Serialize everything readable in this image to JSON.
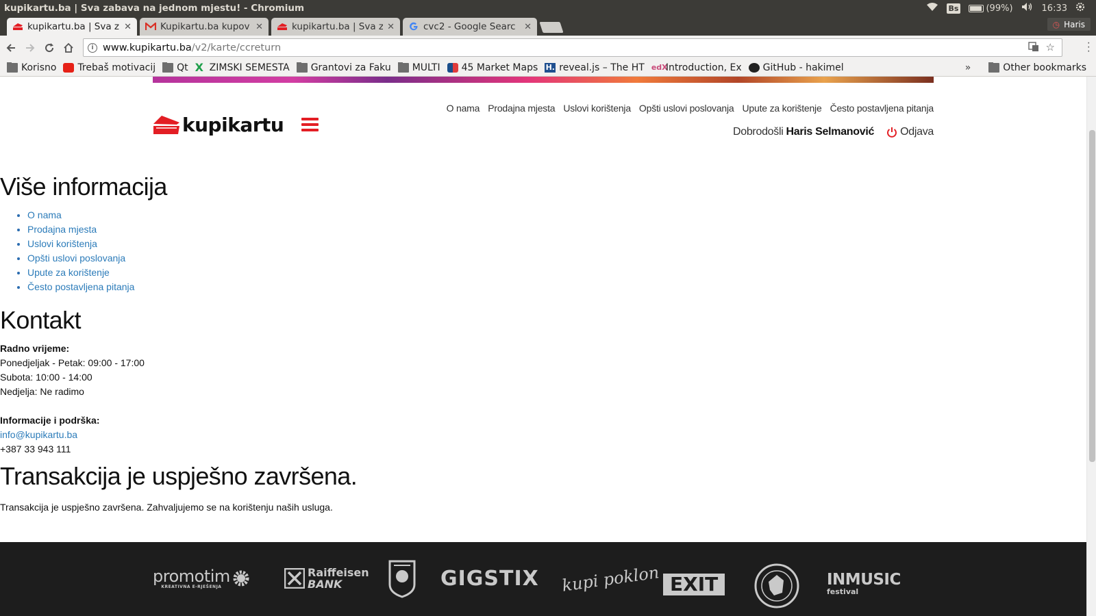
{
  "os": {
    "window_title": "kupikartu.ba | Sva zabava na jednom mjestu! - Chromium",
    "keyboard_layout": "Bs",
    "battery": "(99%)",
    "time": "16:33",
    "user": "Haris"
  },
  "tabs": [
    {
      "title": "kupikartu.ba | Sva z",
      "icon": "kupikartu-favicon",
      "active": true
    },
    {
      "title": "Kupikartu.ba kupov",
      "icon": "gmail-favicon",
      "active": false
    },
    {
      "title": "kupikartu.ba | Sva z",
      "icon": "kupikartu-favicon",
      "active": false
    },
    {
      "title": "cvc2 - Google Searc",
      "icon": "google-favicon",
      "active": false
    }
  ],
  "address": {
    "host": "www.kupikartu.ba",
    "path": "/v2/karte/ccreturn"
  },
  "bookmarks": [
    {
      "label": "Korisno",
      "icon": "folder-icon"
    },
    {
      "label": "Trebaš motivacij",
      "icon": "youtube-icon"
    },
    {
      "label": "Qt",
      "icon": "folder-icon"
    },
    {
      "label": "ZIMSKI SEMESTA",
      "icon": "x-icon"
    },
    {
      "label": "Grantovi za Faku",
      "icon": "folder-icon"
    },
    {
      "label": "MULTI",
      "icon": "folder-icon"
    },
    {
      "label": "45 Market Maps",
      "icon": "app-icon"
    },
    {
      "label": "reveal.js – The HT",
      "icon": "h-icon"
    },
    {
      "label": "Introduction, Ex",
      "icon": "edx-icon"
    },
    {
      "label": "GitHub - hakimel",
      "icon": "github-icon"
    }
  ],
  "bookmarks_more": "»",
  "other_bookmarks": "Other bookmarks",
  "site": {
    "logo_text": "kupikartu",
    "topnav": [
      "O nama",
      "Prodajna mjesta",
      "Uslovi korištenja",
      "Opšti uslovi poslovanja",
      "Upute za korištenje",
      "Često postavljena pitanja"
    ],
    "welcome": "Dobrodošli",
    "user_name": "Haris Selmanović",
    "logout": "Odjava"
  },
  "content": {
    "more_info_heading": "Više informacija",
    "more_info_links": [
      "O nama",
      "Prodajna mjesta",
      "Uslovi korištenja",
      "Opšti uslovi poslovanja",
      "Upute za korištenje",
      "Često postavljena pitanja"
    ],
    "contact_heading": "Kontakt",
    "hours_label": "Radno vrijeme:",
    "hours": [
      "Ponedjeljak - Petak: 09:00 - 17:00",
      "Subota: 10:00 - 14:00",
      "Nedjelja: Ne radimo"
    ],
    "support_label": "Informacije i podrška:",
    "email": "info@kupikartu.ba",
    "phone": "+387 33 943 111",
    "result_heading": "Transakcija je uspješno završena.",
    "result_text": "Transakcija je uspješno završena. Zahvaljujemo se na korištenju naših usluga."
  },
  "footer": {
    "sponsors": [
      {
        "name": "promotim",
        "sub": "KREATIVNA E-RJEŠENJA"
      },
      {
        "name": "Raiffeisen",
        "sub": "BANK"
      },
      {
        "name": "FK Sarajevo crest"
      },
      {
        "name": "GIGSTIX"
      },
      {
        "name": "kupi poklon"
      },
      {
        "name": "EXIT"
      },
      {
        "name": "Bosna and Hercegovina Football Federation crest"
      },
      {
        "name": "INMUSIC",
        "sub": "festival"
      }
    ]
  },
  "colors": {
    "brand_red": "#e31e24",
    "link_blue": "#2b7bb9",
    "footer_bg": "#1d1d1d",
    "os_bar": "#3c3b37"
  }
}
